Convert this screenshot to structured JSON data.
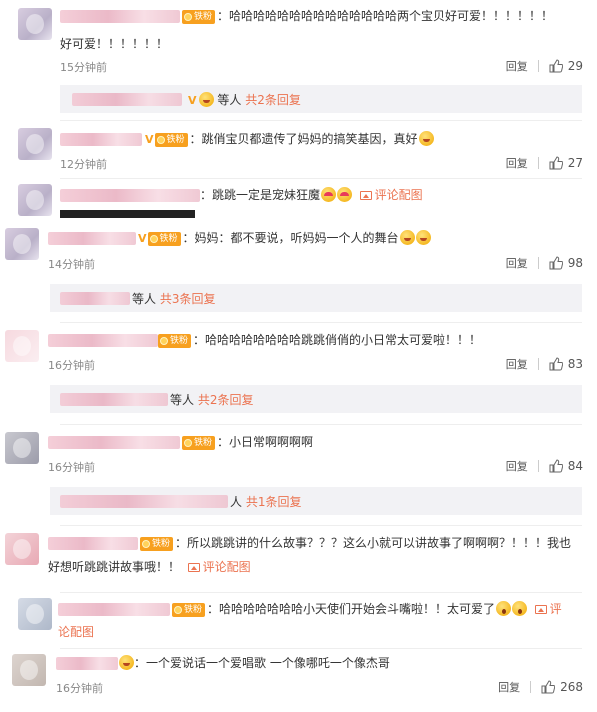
{
  "comments": [
    {
      "text": "：哈哈哈哈哈哈哈哈哈哈哈哈哈哈两个宝贝好可爱！！！！！！",
      "text2": "好可爱！！！！！！",
      "time": "15分钟前",
      "reply": "回复",
      "likes": "29",
      "badge": "铁粉"
    },
    {
      "text": "：跳俏宝贝都遗传了妈妈的搞笑基因，真好",
      "time": "12分钟前",
      "reply": "回复",
      "likes": "27",
      "badge": "铁粉"
    },
    {
      "text": "：跳跳一定是宠妹狂魔",
      "pic": "评论配图"
    },
    {
      "text": "：妈妈：都不要说，听妈妈一个人的舞台",
      "time": "14分钟前",
      "reply": "回复",
      "likes": "98",
      "badge": "铁粉"
    },
    {
      "text": "：哈哈哈哈哈哈哈哈跳跳俏俏的小日常太可爱啦！！！",
      "time": "16分钟前",
      "reply": "回复",
      "likes": "83",
      "badge": "铁粉"
    },
    {
      "text": "：小日常啊啊啊啊",
      "time": "16分钟前",
      "reply": "回复",
      "likes": "84",
      "badge": "铁粉"
    },
    {
      "text": "：所以跳跳讲的什么故事？？？这么小就可以讲故事了啊啊啊？！！！我也",
      "text2": "好想听跳跳讲故事哦！！",
      "pic": "评论配图",
      "badge": "铁粉"
    },
    {
      "text": "：哈哈哈哈哈哈哈小天使们开始会斗嘴啦！！太可爱了",
      "pic_a": "评",
      "pic_b": "论配图",
      "badge": "铁粉"
    },
    {
      "text": "：一个爱说话一个爱唱歌 一个像哪吒一个像杰哥",
      "time": "16分钟前",
      "reply": "回复",
      "likes": "268"
    }
  ],
  "reply_bars": [
    {
      "people": "等人",
      "link": "共2条回复"
    },
    {
      "people": "等人",
      "link": "共3条回复"
    },
    {
      "people": "等人",
      "link": "共2条回复"
    },
    {
      "people": "人",
      "link": "共1条回复"
    }
  ],
  "vip_mark": "V",
  "colors": {
    "link": "#eb7350",
    "badge": "#f7a01f",
    "reply_bg": "#f2f2f5",
    "blur": "#f3c9d4"
  }
}
